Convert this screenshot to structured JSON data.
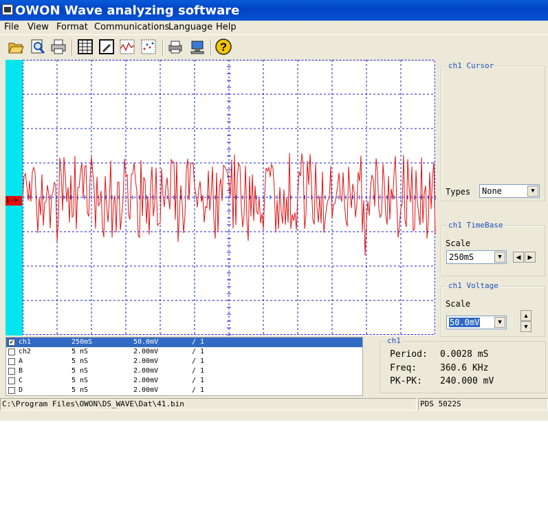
{
  "window": {
    "title": "OWON Wave analyzing software"
  },
  "menu": [
    "File",
    "View",
    "Format",
    "Communications",
    "Language",
    "Help"
  ],
  "toolbar": {
    "buttons": [
      "open-icon",
      "print-preview-icon",
      "print-icon",
      "table-icon",
      "edit-icon",
      "waveform-icon",
      "points-icon",
      "printer-setup-icon",
      "connect-icon",
      "help-icon"
    ],
    "help_glyph": "?"
  },
  "scope": {
    "channel_marker": "1->",
    "trace_color": "#e01010",
    "grid_color": "#1a1acc",
    "strip_color": "#00e5ee"
  },
  "cursor": {
    "title": "ch1 Cursor",
    "types_label": "Types",
    "types_value": "None"
  },
  "timebase": {
    "title": "ch1 TimeBase",
    "scale_label": "Scale",
    "scale_value": "250mS"
  },
  "voltage": {
    "title": "ch1 Voltage",
    "scale_label": "Scale",
    "scale_value": "50.0mV"
  },
  "channels": [
    {
      "name": "ch1",
      "timebase": "250mS",
      "volts": "50.0mV",
      "probe": "/ 1",
      "checked": true,
      "selected": true
    },
    {
      "name": "ch2",
      "timebase": "5  nS",
      "volts": "2.00mV",
      "probe": "/ 1",
      "checked": false,
      "selected": false
    },
    {
      "name": "A",
      "timebase": "5  nS",
      "volts": "2.00mV",
      "probe": "/ 1",
      "checked": false,
      "selected": false
    },
    {
      "name": "B",
      "timebase": "5  nS",
      "volts": "2.00mV",
      "probe": "/ 1",
      "checked": false,
      "selected": false
    },
    {
      "name": "C",
      "timebase": "5  nS",
      "volts": "2.00mV",
      "probe": "/ 1",
      "checked": false,
      "selected": false
    },
    {
      "name": "D",
      "timebase": "5  nS",
      "volts": "2.00mV",
      "probe": "/ 1",
      "checked": false,
      "selected": false
    }
  ],
  "measurements": {
    "title": "ch1",
    "period_label": "Period:",
    "period_value": "0.0028 mS",
    "freq_label": "Freq:",
    "freq_value": "360.6 KHz",
    "pkpk_label": "PK-PK:",
    "pkpk_value": "240.000 mV"
  },
  "status": {
    "path": "C:\\Program Files\\OWON\\DS_WAVE\\Dat\\41.bin",
    "model": "PDS 5022S"
  }
}
